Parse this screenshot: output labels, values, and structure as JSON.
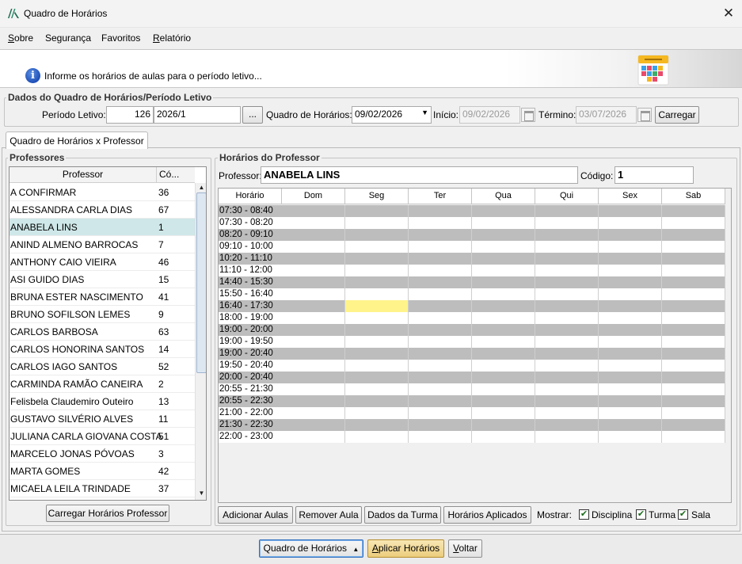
{
  "window": {
    "title": "Quadro de Horários"
  },
  "menu": [
    {
      "label_u": "S",
      "label_rest": "obre"
    },
    {
      "label_u": "",
      "label_rest": "Segurança"
    },
    {
      "label_u": "",
      "label_rest": "Favoritos"
    },
    {
      "label_u": "R",
      "label_rest": "elatório"
    }
  ],
  "banner": {
    "text": "Informe os horários de aulas para o período letivo..."
  },
  "dados": {
    "legend": "Dados do Quadro de Horários/Período Letivo",
    "periodo_label": "Período Letivo:",
    "periodo_code": "126",
    "periodo_value": "2026/1",
    "ellipsis": "...",
    "quadro_label": "Quadro de Horários:",
    "quadro_value": "09/02/2026",
    "inicio_label": "Início:",
    "inicio_value": "09/02/2026",
    "termino_label": "Término:",
    "termino_value": "03/07/2026",
    "carregar_label": "Carregar"
  },
  "tab": {
    "label": "Quadro de Horários x Professor"
  },
  "professores": {
    "legend": "Professores",
    "col_name": "Professor",
    "col_code": "Có...",
    "rows": [
      {
        "name": "A CONFIRMAR",
        "code": "36"
      },
      {
        "name": "ALESSANDRA CARLA DIAS",
        "code": "67"
      },
      {
        "name": "ANABELA LINS",
        "code": "1"
      },
      {
        "name": "ANIND ALMENO BARROCAS",
        "code": "7"
      },
      {
        "name": "ANTHONY CAIO VIEIRA",
        "code": "46"
      },
      {
        "name": "ASI GUIDO DIAS",
        "code": "15"
      },
      {
        "name": "BRUNA ESTER NASCIMENTO",
        "code": "41"
      },
      {
        "name": "BRUNO SOFILSON LEMES",
        "code": "9"
      },
      {
        "name": "CARLOS BARBOSA",
        "code": "63"
      },
      {
        "name": "CARLOS HONORINA SANTOS",
        "code": "14"
      },
      {
        "name": "CARLOS IAGO SANTOS",
        "code": "52"
      },
      {
        "name": "CARMINDA RAMÃO CANEIRA",
        "code": "2"
      },
      {
        "name": "Felisbela Claudemiro Outeiro",
        "code": "13"
      },
      {
        "name": "GUSTAVO SILVÉRIO ALVES",
        "code": "11"
      },
      {
        "name": "JULIANA CARLA GIOVANA COSTA",
        "code": "51"
      },
      {
        "name": "MARCELO JONAS PÓVOAS",
        "code": "3"
      },
      {
        "name": "MARTA GOMES",
        "code": "42"
      },
      {
        "name": "MICAELA LEILA TRINDADE",
        "code": "37"
      }
    ],
    "selected_index": 2,
    "load_button": "Carregar Horários Professor"
  },
  "horarios": {
    "legend": "Horários do Professor",
    "professor_label": "Professor:",
    "professor_value": "ANABELA LINS",
    "codigo_label": "Código:",
    "codigo_value": "1",
    "columns": [
      "Horário",
      "Dom",
      "Seg",
      "Ter",
      "Qua",
      "Qui",
      "Sex",
      "Sab"
    ],
    "rows": [
      {
        "time": "07:30 - 08:40",
        "shaded": true
      },
      {
        "time": "07:30 - 08:20",
        "shaded": false
      },
      {
        "time": "08:20 - 09:10",
        "shaded": true
      },
      {
        "time": "09:10 - 10:00",
        "shaded": false
      },
      {
        "time": "10:20 - 11:10",
        "shaded": true
      },
      {
        "time": "11:10 - 12:00",
        "shaded": false
      },
      {
        "time": "14:40 - 15:30",
        "shaded": true
      },
      {
        "time": "15:50 - 16:40",
        "shaded": false
      },
      {
        "time": "16:40 - 17:30",
        "shaded": true,
        "highlight_col": 2
      },
      {
        "time": "18:00 - 19:00",
        "shaded": false
      },
      {
        "time": "19:00 - 20:00",
        "shaded": true
      },
      {
        "time": "19:00 - 19:50",
        "shaded": false
      },
      {
        "time": "19:00 - 20:40",
        "shaded": true
      },
      {
        "time": "19:50 - 20:40",
        "shaded": false
      },
      {
        "time": "20:00 - 20:40",
        "shaded": true
      },
      {
        "time": "20:55 - 21:30",
        "shaded": false
      },
      {
        "time": "20:55 - 22:30",
        "shaded": true
      },
      {
        "time": "21:00 - 22:00",
        "shaded": false
      },
      {
        "time": "21:30 - 22:30",
        "shaded": true
      },
      {
        "time": "22:00 - 23:00",
        "shaded": false
      }
    ],
    "highlight_color": "#fff38a",
    "shade_color": "#bdbdbd"
  },
  "actions": {
    "adicionar": "Adicionar Aulas",
    "remover": "Remover Aula",
    "dados_turma": "Dados da Turma",
    "horarios_aplicados": "Horários Aplicados",
    "mostrar_label": "Mostrar:",
    "checks": [
      {
        "label": "Disciplina",
        "checked": true
      },
      {
        "label": "Turma",
        "checked": true
      },
      {
        "label": "Sala",
        "checked": true
      }
    ]
  },
  "bottom": {
    "quadro_btn": "Quadro de Horários",
    "aplicar_u": "A",
    "aplicar_rest": "plicar Horários",
    "voltar_u": "V",
    "voltar_rest": "oltar"
  }
}
